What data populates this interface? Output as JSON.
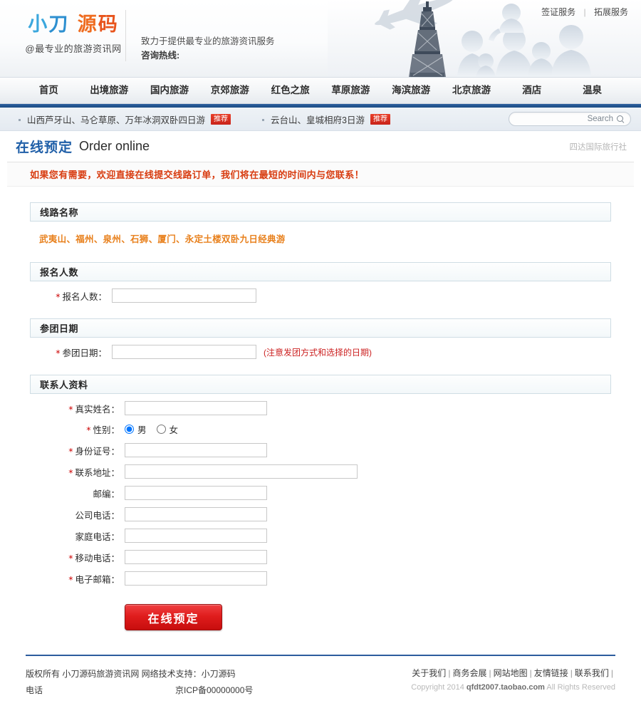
{
  "header": {
    "logo_chars": [
      "小",
      "刀",
      "源",
      "码"
    ],
    "logo_tagline": "@最专业的旅游资讯网",
    "slogan_line1": "致力于提供最专业的旅游资讯服务",
    "slogan_line2": "咨询热线:",
    "top_links": [
      {
        "label": "签证服务"
      },
      {
        "label": "拓展服务"
      }
    ]
  },
  "nav": {
    "items": [
      {
        "label": "首页"
      },
      {
        "label": "出境旅游"
      },
      {
        "label": "国内旅游"
      },
      {
        "label": "京郊旅游"
      },
      {
        "label": "红色之旅"
      },
      {
        "label": "草原旅游"
      },
      {
        "label": "海滨旅游"
      },
      {
        "label": "北京旅游"
      },
      {
        "label": "酒店"
      },
      {
        "label": "温泉"
      }
    ]
  },
  "ticker": {
    "items": [
      {
        "label": "山西芦牙山、马仑草原、万年冰洞双卧四日游",
        "tag": "推荐"
      },
      {
        "label": "云台山、皇城相府3日游",
        "tag": "推荐"
      }
    ]
  },
  "search": {
    "placeholder": "Search",
    "value": "",
    "icon": "search-icon"
  },
  "page_title": {
    "cn": "在线预定",
    "en": "Order online",
    "agency": "四达国际旅行社"
  },
  "notice": "如果您有需要，欢迎直接在线提交线路订单，我们将在最短的时间内与您联系！",
  "sections": {
    "route": {
      "heading": "线路名称",
      "route_name": "武夷山、福州、泉州、石狮、厦门、永定土楼双卧九日经典游"
    },
    "people": {
      "heading": "报名人数",
      "field": {
        "label": "报名人数：",
        "required": true,
        "value": "",
        "placeholder": ""
      }
    },
    "date": {
      "heading": "参团日期",
      "field": {
        "label": "参团日期：",
        "required": true,
        "value": "",
        "placeholder": ""
      },
      "hint": "(注意发团方式和选择的日期)"
    },
    "contact": {
      "heading": "联系人资料",
      "fields": [
        {
          "label": "真实姓名：",
          "required": true,
          "type": "text",
          "width": "w200",
          "value": ""
        },
        {
          "label": "性别：",
          "required": true,
          "type": "radio",
          "options": [
            {
              "label": "男",
              "checked": true
            },
            {
              "label": "女",
              "checked": false
            }
          ]
        },
        {
          "label": "身份证号：",
          "required": true,
          "type": "text",
          "width": "w200",
          "value": ""
        },
        {
          "label": "联系地址：",
          "required": true,
          "type": "text",
          "width": "w327",
          "value": ""
        },
        {
          "label": "邮编：",
          "required": false,
          "type": "text",
          "width": "w200",
          "value": ""
        },
        {
          "label": "公司电话：",
          "required": false,
          "type": "text",
          "width": "w200",
          "value": ""
        },
        {
          "label": "家庭电话：",
          "required": false,
          "type": "text",
          "width": "w200",
          "value": ""
        },
        {
          "label": "移动电话：",
          "required": true,
          "type": "text",
          "width": "w200",
          "value": ""
        },
        {
          "label": "电子邮箱：",
          "required": true,
          "type": "text",
          "width": "w200",
          "value": ""
        }
      ]
    }
  },
  "submit_button": "在线预定",
  "footer": {
    "copyright_left": "版权所有  小刀源码旅游资讯网   网络技术支持：小刀源码",
    "phone_label": "电话",
    "icp": "京ICP备00000000号",
    "links": [
      {
        "label": "关于我们"
      },
      {
        "label": "商务会展"
      },
      {
        "label": "网站地图"
      },
      {
        "label": "友情链接"
      },
      {
        "label": "联系我们"
      }
    ],
    "copyright_prefix": "Copyright 2014",
    "copyright_domain": "qfdt2007.taobao.com",
    "copyright_suffix": "All Rights Reserved"
  },
  "colors": {
    "brand_blue": "#1f5fa8",
    "nav_strip": "#2d5c9e",
    "accent_red": "#d83c10",
    "route_orange": "#e8801c",
    "button_red": "#e01d1d"
  }
}
